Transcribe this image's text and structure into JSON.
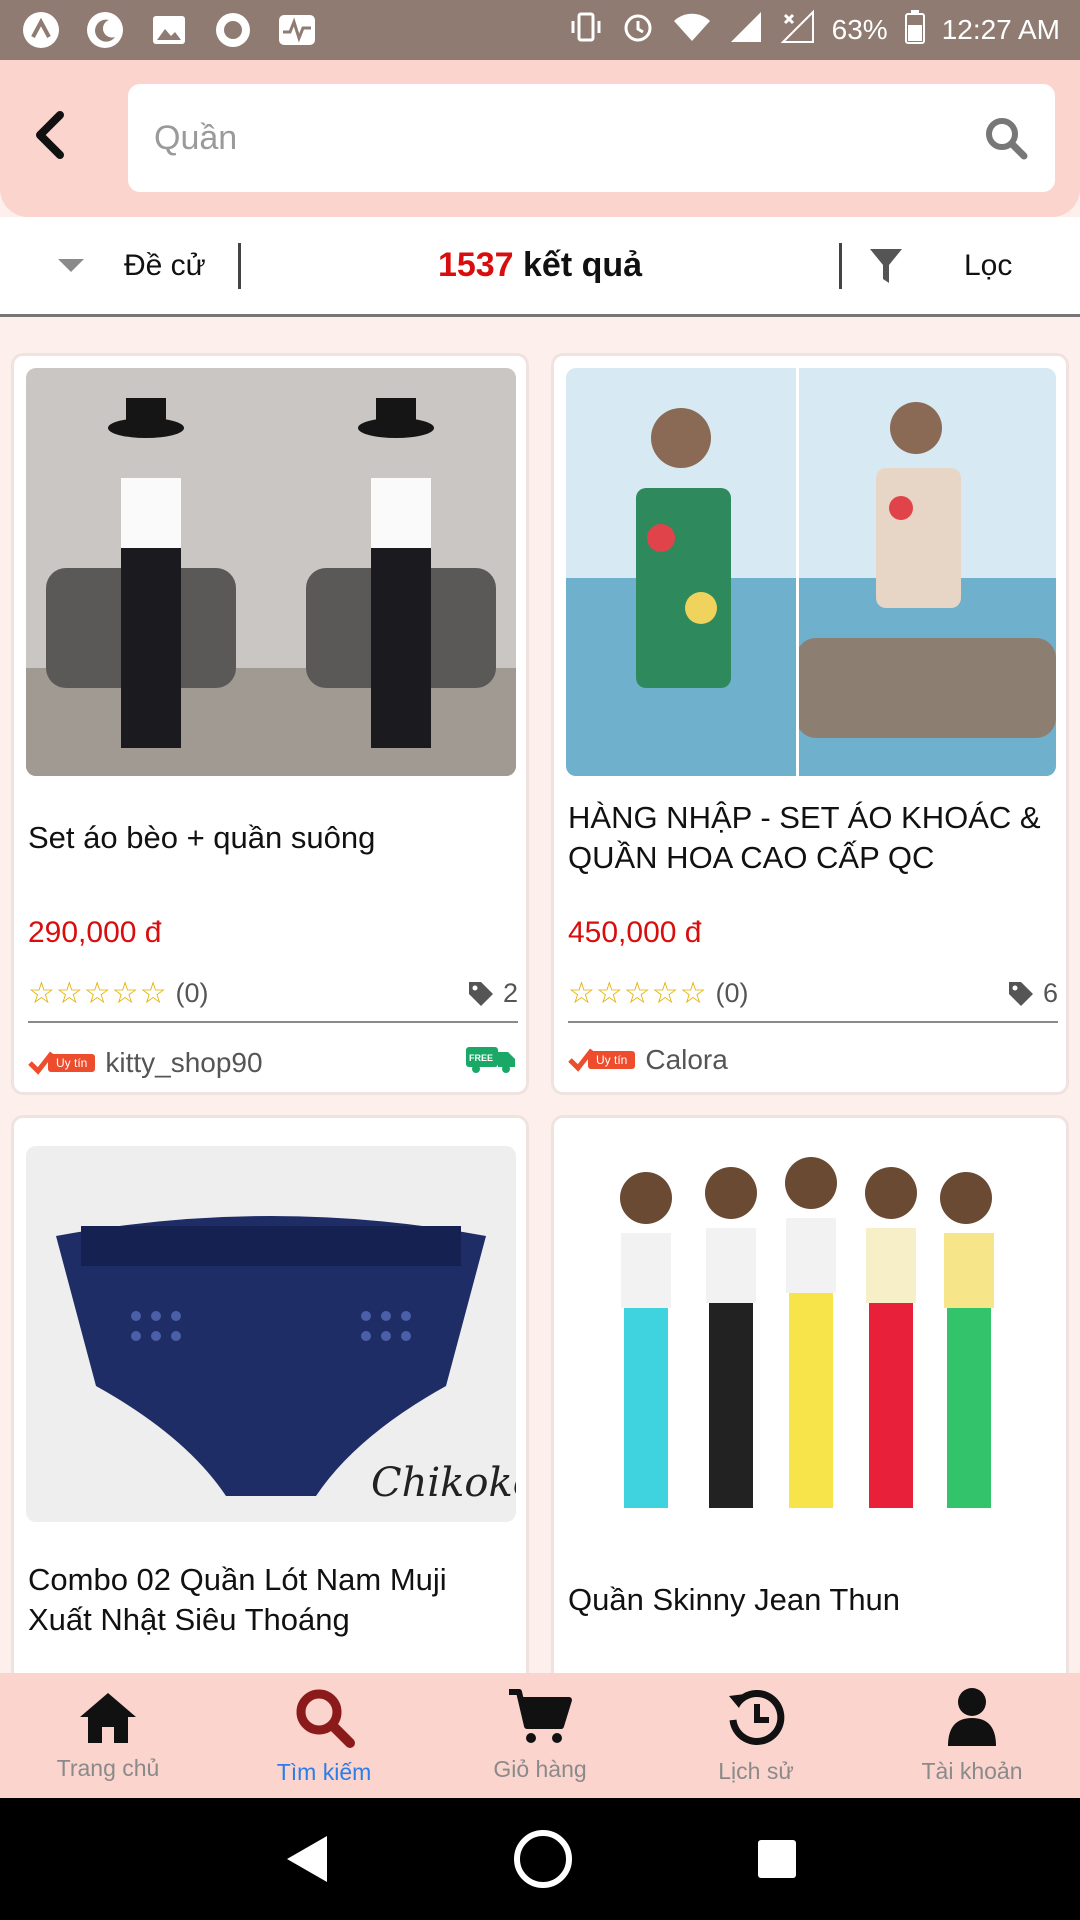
{
  "status_bar": {
    "battery": "63%",
    "time": "12:27 AM"
  },
  "search": {
    "placeholder": "Quần",
    "value": ""
  },
  "filter_bar": {
    "sort_label": "Đề cử",
    "result_count": "1537",
    "result_suffix": " kết quả",
    "filter_label": "Lọc"
  },
  "products": [
    {
      "title": "Set áo bèo + quần suông",
      "price": "290,000 đ",
      "reviews": "(0)",
      "tag_count": "2",
      "badge": "Uy tín",
      "shop": "kitty_shop90",
      "free_ship": "FREE"
    },
    {
      "title": "HÀNG NHẬP - SET ÁO KHOÁC & QUẦN HOA CAO CẤP QC",
      "price": "450,000 đ",
      "reviews": "(0)",
      "tag_count": "6",
      "badge": "Uy tín",
      "shop": "Calora"
    },
    {
      "title": "Combo 02 Quần Lót Nam Muji Xuất Nhật Siêu Thoáng",
      "image_text": "Chikoko"
    },
    {
      "title": "Quần Skinny Jean Thun"
    }
  ],
  "bottom_nav": [
    {
      "label": "Trang chủ",
      "icon": "home-icon"
    },
    {
      "label": "Tìm kiếm",
      "icon": "search-icon"
    },
    {
      "label": "Giỏ hàng",
      "icon": "cart-icon"
    },
    {
      "label": "Lịch sử",
      "icon": "history-icon"
    },
    {
      "label": "Tài khoản",
      "icon": "user-icon"
    }
  ],
  "colors": {
    "accent_red": "#d80d0d",
    "header_pink": "#fbd4cd",
    "active_blue": "#2b7de9",
    "active_icon": "#8b1a1a"
  }
}
